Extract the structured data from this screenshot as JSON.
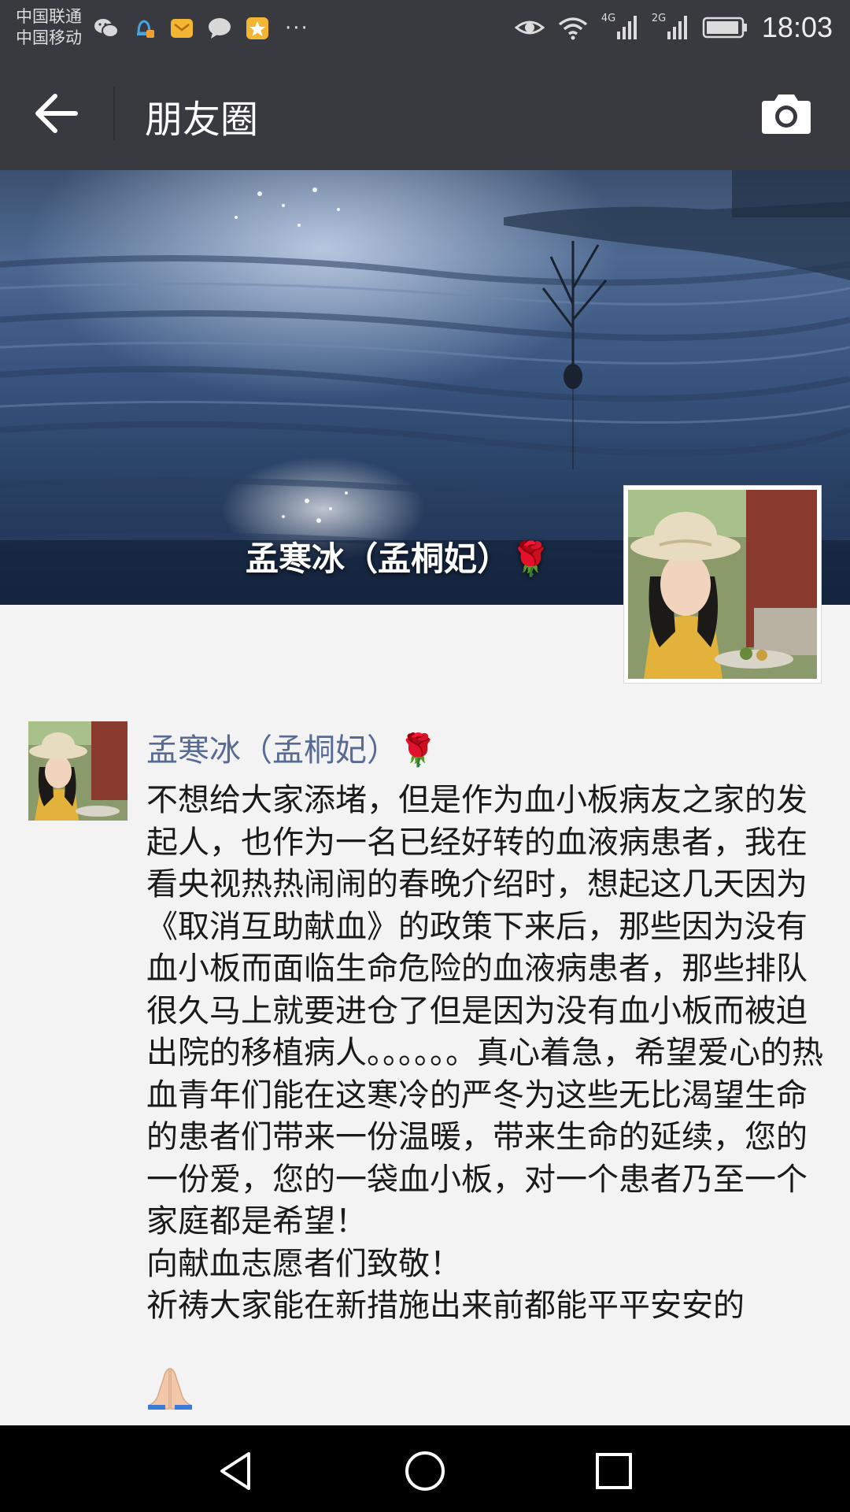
{
  "status_bar": {
    "carrier_1": "中国联通",
    "carrier_2": "中国移动",
    "network_1": "4G",
    "network_2": "2G",
    "more": "···",
    "time": "18:03"
  },
  "header": {
    "title": "朋友圈"
  },
  "cover": {
    "display_name": "孟寒冰（孟桐妃）🌹"
  },
  "post": {
    "author": "孟寒冰（孟桐妃）🌹",
    "text": "不想给大家添堵，但是作为血小板病友之家的发起人，也作为一名已经好转的血液病患者，我在看央视热热闹闹的春晚介绍时，想起这几天因为《取消互助献血》的政策下来后，那些因为没有血小板而面临生命危险的血液病患者，那些排队很久马上就要进仓了但是因为没有血小板而被迫出院的移植病人。。。。。。真心着急，希望爱心的热血青年们能在这寒冷的严冬为这些无比渴望生命的患者们带来一份温暖，带来生命的延续，您的一份爱，您的一袋血小板，对一个患者乃至一个家庭都是希望！\n向献血志愿者们致敬！\n祈祷大家能在新措施出来前都能平平安安的"
  },
  "icons": {
    "back": "arrow-left-icon",
    "camera": "camera-icon",
    "pray": "praying-hands-icon",
    "nav_back": "triangle-back-icon",
    "nav_home": "circle-home-icon",
    "nav_recents": "square-recents-icon"
  },
  "colors": {
    "bar": "#393a3f",
    "link": "#576b95",
    "background": "#f3f3f3"
  }
}
